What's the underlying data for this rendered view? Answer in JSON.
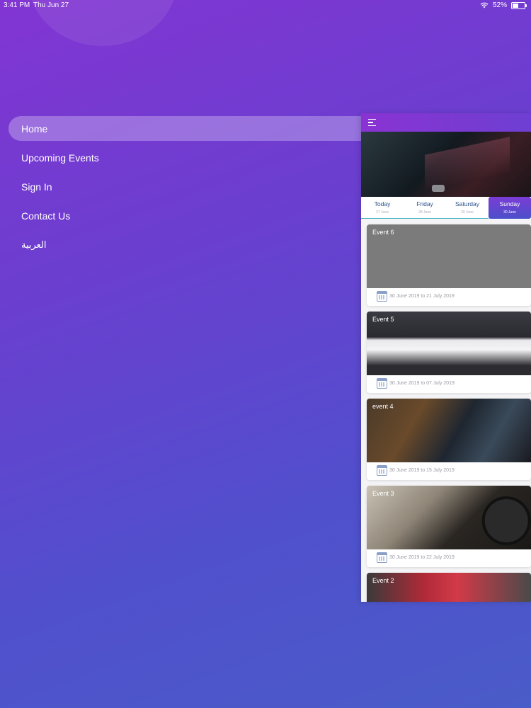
{
  "status_bar": {
    "time": "3:41 PM",
    "date": "Thu Jun 27",
    "battery": "52%",
    "battery_level": 0.52
  },
  "menu": {
    "items": [
      {
        "label": "Home",
        "active": true
      },
      {
        "label": "Upcoming Events",
        "active": false
      },
      {
        "label": "Sign In",
        "active": false
      },
      {
        "label": "Contact Us",
        "active": false
      },
      {
        "label": "العربية",
        "active": false
      }
    ]
  },
  "panel": {
    "days": [
      {
        "name": "Today",
        "date": "27 June"
      },
      {
        "name": "Friday",
        "date": "28 June"
      },
      {
        "name": "Saturday",
        "date": "29 June"
      },
      {
        "name": "Sunday",
        "date": "30 June",
        "active": true
      }
    ],
    "events": [
      {
        "title": "Event 6",
        "range": "30 June 2019 to 21 July 2019"
      },
      {
        "title": "Event 5",
        "range": "30 June 2019 to 07 July 2019"
      },
      {
        "title": "event 4",
        "range": "30 June 2019 to 15 July 2019"
      },
      {
        "title": "Event 3",
        "range": "30 June 2019 to 22 July 2019"
      },
      {
        "title": "Event 2",
        "range": ""
      }
    ]
  },
  "colors": {
    "accent": "#7b3bd6",
    "background_top": "#8235d2",
    "background_bottom": "#4a5cc8"
  }
}
